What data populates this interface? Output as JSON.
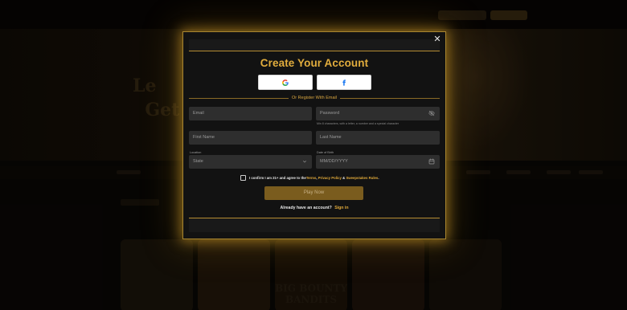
{
  "background": {
    "game_labels": [
      "",
      "",
      "BIG BOUNTY BANDITS",
      "",
      ""
    ]
  },
  "modal": {
    "close_symbol": "✕",
    "title": "Create Your Account",
    "social": [
      {
        "provider": "google",
        "icon": "google-icon"
      },
      {
        "provider": "facebook",
        "icon": "facebook-icon"
      }
    ],
    "divider_text": "Or Register With Email",
    "email_placeholder": "Email",
    "password_placeholder": "Password",
    "password_hint": "Min 8 characters, with a letter, a number and a special character",
    "first_name_placeholder": "First Name",
    "last_name_placeholder": "Last Name",
    "location_label": "Location",
    "state_placeholder": "State",
    "dob_label": "Date of Birth",
    "dob_placeholder": "MM/DD/YYYY",
    "confirm_prefix": "I confirm I am 21+ and agree to the ",
    "terms_link": "Terms",
    "privacy_link": "Privacy Policy",
    "sweepstakes_link": "Sweepstakes Rules",
    "play_button": "Play Now",
    "already_text": "Already have an account?",
    "sign_in_link": "Sign in"
  },
  "colors": {
    "accent_gold": "#e2ad3d",
    "modal_bg": "#121212",
    "field_bg": "#2e2e2e",
    "button_bg": "#7a5c1e"
  }
}
